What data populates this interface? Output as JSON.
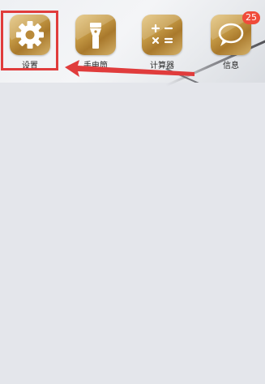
{
  "apps": [
    {
      "label": "设置",
      "icon": "gear-icon"
    },
    {
      "label": "手电筒",
      "icon": "flashlight-icon"
    },
    {
      "label": "计算器",
      "icon": "calculator-icon"
    },
    {
      "label": "信息",
      "icon": "message-bubble-icon",
      "badge": "25"
    }
  ],
  "annotation": {
    "highlight_color": "#e03c3c",
    "arrow_color": "#e03c3c",
    "target": "设置"
  },
  "colors": {
    "icon_gold": "#c59a45",
    "badge_red": "#f04b3a",
    "background": "#e4e6eb"
  }
}
